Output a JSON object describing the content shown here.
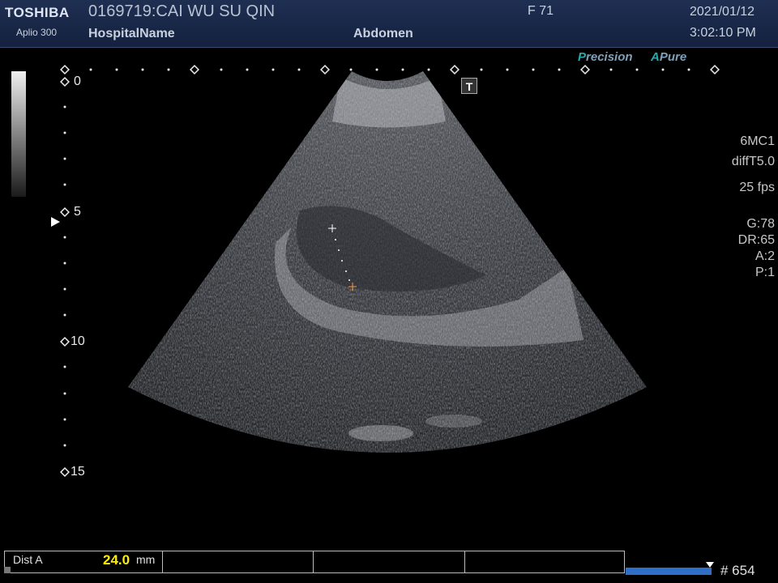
{
  "header": {
    "brand": "TOSHIBA",
    "model": "Aplio 300",
    "patient": "0169719:CAI WU SU QIN",
    "hospital": "HospitalName",
    "sex_age": "F  71",
    "preset": "Abdomen",
    "date": "2021/01/12",
    "time": "3:02:10 PM"
  },
  "tags": {
    "precision_first": "P",
    "precision_rest": "recision",
    "apure_first": "A",
    "apure_rest": "Pure"
  },
  "params": {
    "probe": "6MC1",
    "mode": "diffT5.0",
    "fps": "25 fps",
    "gain": "G:78",
    "dr": "DR:65",
    "a": "A:2",
    "p": "P:1"
  },
  "depth_labels": {
    "d0": "0",
    "d5": "5",
    "d10": "10",
    "d15": "15"
  },
  "t_icon": "T",
  "measurement": {
    "label": "Dist A",
    "value": "24.0",
    "unit": "mm"
  },
  "cine": {
    "frame": "# 654"
  }
}
